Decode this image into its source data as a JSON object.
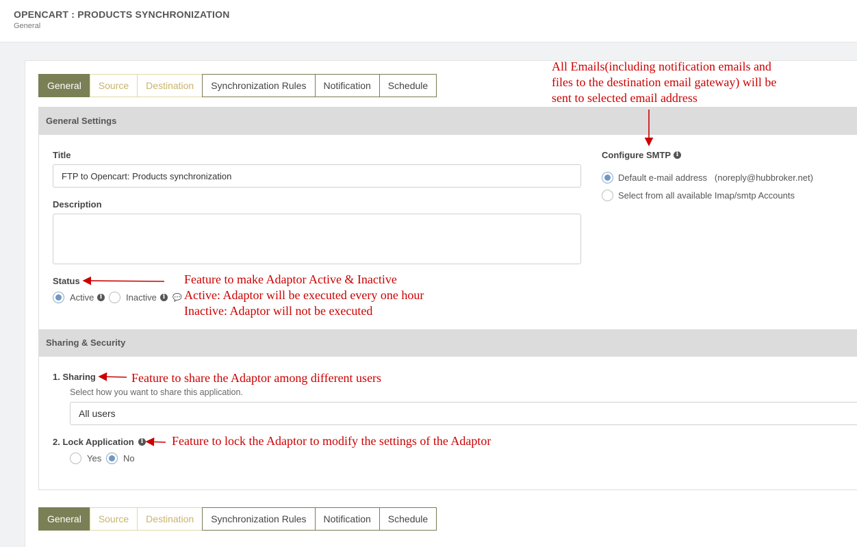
{
  "header": {
    "title": "OPENCART : PRODUCTS SYNCHRONIZATION",
    "subtitle": "General"
  },
  "tabs": [
    "General",
    "Source",
    "Destination",
    "Synchronization Rules",
    "Notification",
    "Schedule"
  ],
  "general_settings": {
    "heading": "General Settings",
    "title_label": "Title",
    "title_value": "FTP to Opencart: Products synchronization",
    "description_label": "Description",
    "description_value": "",
    "status_label": "Status",
    "status_active": "Active",
    "status_inactive": "Inactive"
  },
  "smtp": {
    "label": "Configure SMTP",
    "default_option": "Default e-mail address",
    "default_email": "(noreply@hubbroker.net)",
    "other_option": "Select from all available Imap/smtp Accounts"
  },
  "sharing": {
    "heading": "Sharing & Security",
    "sharing_label": "1. Sharing",
    "sharing_hint": "Select how you want to share this application.",
    "sharing_value": "All users",
    "lock_label": "2. Lock Application",
    "lock_yes": "Yes",
    "lock_no": "No"
  },
  "annotations": {
    "smtp": [
      "All Emails(including notification emails and",
      "files to the destination email gateway) will be",
      "sent to selected email address"
    ],
    "status": [
      "Feature to make Adaptor Active & Inactive",
      "Active: Adaptor will be executed every one hour",
      "Inactive: Adaptor will not be executed"
    ],
    "sharing": "Feature to share the Adaptor among different users",
    "lock": "Feature to lock the Adaptor to modify the settings of the Adaptor"
  },
  "colors": {
    "tab_active": "#7b7f55",
    "tab_muted_text": "#c8b46a",
    "annotation": "#cc0000",
    "radio": "#6f98c2"
  }
}
